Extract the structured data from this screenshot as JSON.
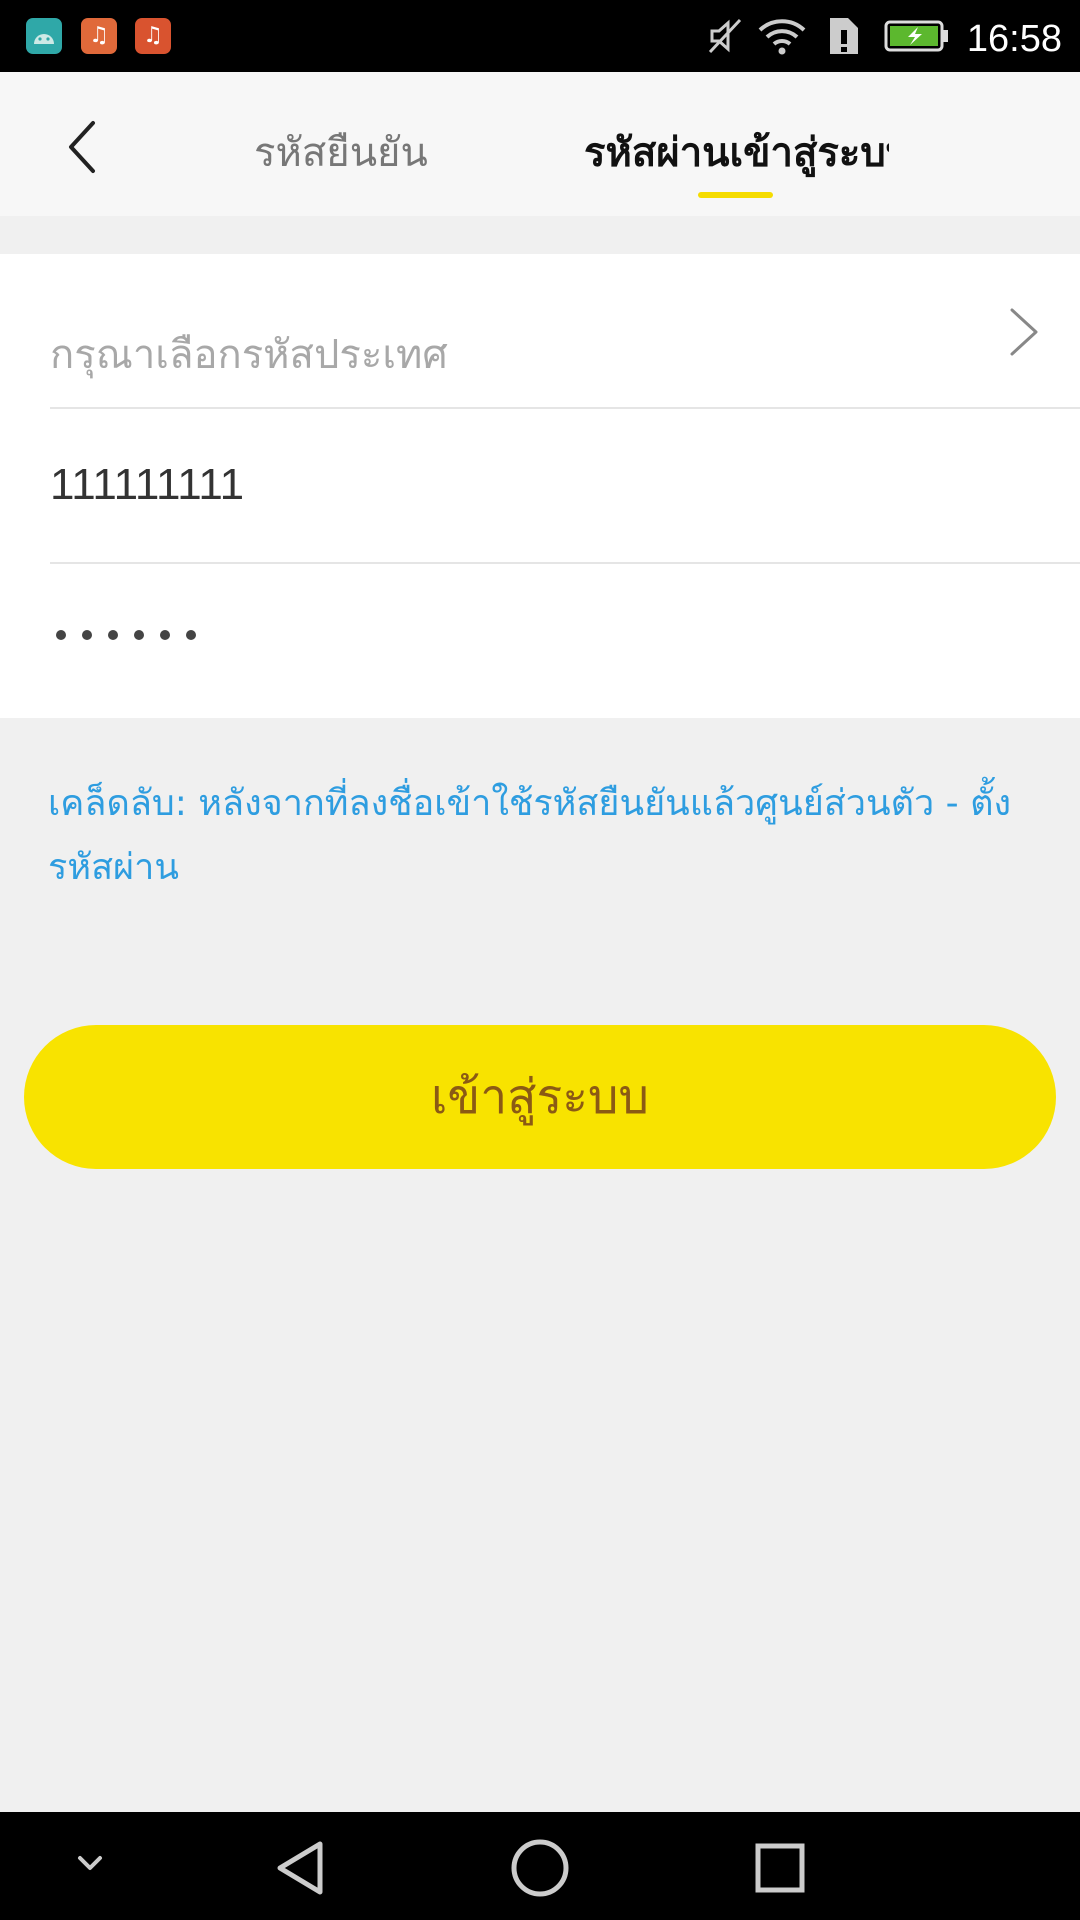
{
  "status_bar": {
    "time": "16:58",
    "app_icons": [
      "android-icon",
      "music-icon",
      "music-icon"
    ],
    "system_icons": [
      "mute-icon",
      "wifi-icon",
      "sim-alert-icon",
      "battery-charging-icon"
    ]
  },
  "header": {
    "back_icon": "chevron-left-icon",
    "tabs": [
      {
        "label": "รหัสยืนยัน",
        "active": false
      },
      {
        "label": "รหัสผ่านเข้าสู่ระบบ",
        "active": true
      }
    ],
    "accent_color": "#f5dc00"
  },
  "form": {
    "country_placeholder": "กรุณาเลือกรหัสประเทศ",
    "phone_value": "111111111",
    "password_value": "••••••"
  },
  "tip": {
    "text": "เคล็ดลับ: หลังจากที่ลงชื่อเข้าใช้รหัสยืนยันแล้วศูนย์ส่วนตัว - ตั้งรหัสผ่าน",
    "color": "#2e9de0"
  },
  "login_button": {
    "label": "เข้าสู่ระบบ",
    "color": "#f8e300"
  },
  "nav_bar": {
    "icons": [
      "collapse-icon",
      "back-triangle-icon",
      "home-circle-icon",
      "recents-square-icon"
    ]
  }
}
